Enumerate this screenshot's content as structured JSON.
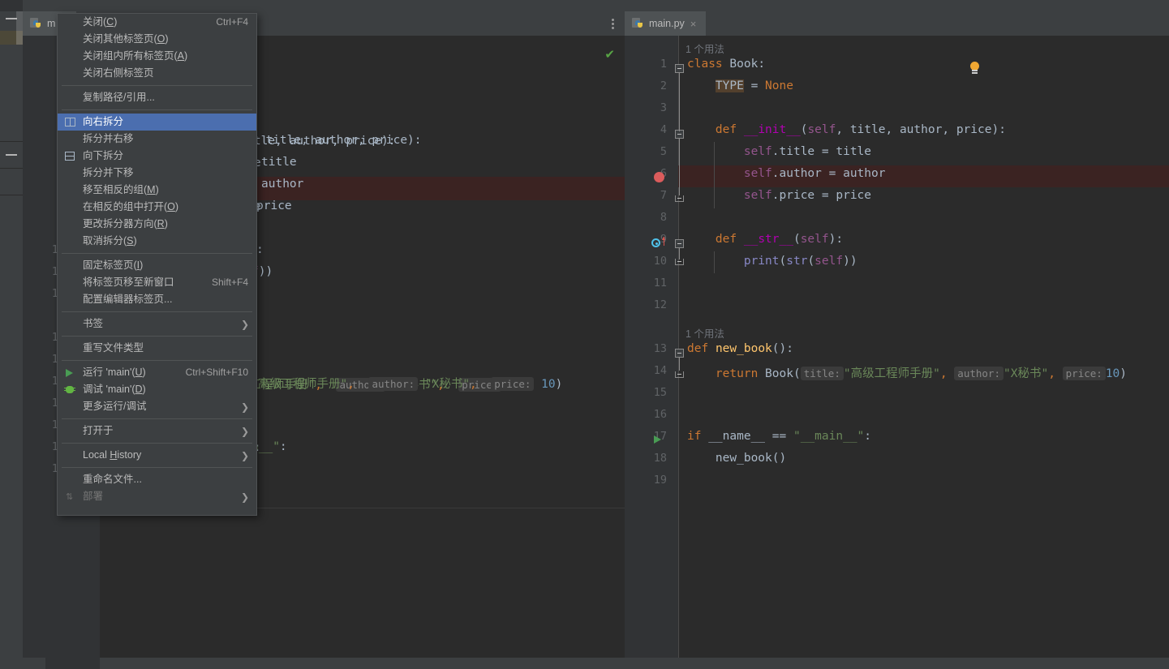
{
  "window": {
    "left_tab": {
      "label": "m",
      "icon": "python-file-icon"
    },
    "right_tab": {
      "label": "main.py",
      "icon": "python-file-icon",
      "close": "×"
    },
    "inspection_ok": "✔",
    "options_menu": "more-options-icon"
  },
  "context_menu": {
    "items": [
      {
        "kind": "item",
        "label": "关闭(C)",
        "underline": "C",
        "accel": "Ctrl+F4",
        "icon": "",
        "selected": false,
        "disabled": false,
        "submenu": false
      },
      {
        "kind": "item",
        "label": "关闭其他标签页(O)",
        "underline": "O",
        "accel": "",
        "icon": "",
        "selected": false,
        "disabled": false,
        "submenu": false
      },
      {
        "kind": "item",
        "label": "关闭组内所有标签页(A)",
        "underline": "A",
        "accel": "",
        "icon": "",
        "selected": false,
        "disabled": false,
        "submenu": false
      },
      {
        "kind": "item",
        "label": "关闭右侧标签页",
        "underline": "",
        "accel": "",
        "icon": "",
        "selected": false,
        "disabled": false,
        "submenu": false
      },
      {
        "kind": "sep"
      },
      {
        "kind": "item",
        "label": "复制路径/引用...",
        "underline": "",
        "accel": "",
        "icon": "",
        "selected": false,
        "disabled": false,
        "submenu": false
      },
      {
        "kind": "sep"
      },
      {
        "kind": "item",
        "label": "向右拆分",
        "underline": "",
        "accel": "",
        "icon": "split-right-icon",
        "selected": true,
        "disabled": false,
        "submenu": false
      },
      {
        "kind": "item",
        "label": "拆分并右移",
        "underline": "",
        "accel": "",
        "icon": "",
        "selected": false,
        "disabled": false,
        "submenu": false
      },
      {
        "kind": "item",
        "label": "向下拆分",
        "underline": "",
        "accel": "",
        "icon": "split-down-icon",
        "selected": false,
        "disabled": false,
        "submenu": false
      },
      {
        "kind": "item",
        "label": "拆分并下移",
        "underline": "",
        "accel": "",
        "icon": "",
        "selected": false,
        "disabled": false,
        "submenu": false
      },
      {
        "kind": "item",
        "label": "移至相反的组(M)",
        "underline": "M",
        "accel": "",
        "icon": "",
        "selected": false,
        "disabled": false,
        "submenu": false
      },
      {
        "kind": "item",
        "label": "在相反的组中打开(O)",
        "underline": "O",
        "accel": "",
        "icon": "",
        "selected": false,
        "disabled": false,
        "submenu": false
      },
      {
        "kind": "item",
        "label": "更改拆分器方向(R)",
        "underline": "R",
        "accel": "",
        "icon": "",
        "selected": false,
        "disabled": false,
        "submenu": false
      },
      {
        "kind": "item",
        "label": "取消拆分(S)",
        "underline": "S",
        "accel": "",
        "icon": "",
        "selected": false,
        "disabled": false,
        "submenu": false
      },
      {
        "kind": "sep"
      },
      {
        "kind": "item",
        "label": "固定标签页(I)",
        "underline": "I",
        "accel": "",
        "icon": "",
        "selected": false,
        "disabled": false,
        "submenu": false
      },
      {
        "kind": "item",
        "label": "将标签页移至新窗口",
        "underline": "",
        "accel": "Shift+F4",
        "icon": "",
        "selected": false,
        "disabled": false,
        "submenu": false
      },
      {
        "kind": "item",
        "label": "配置编辑器标签页...",
        "underline": "",
        "accel": "",
        "icon": "",
        "selected": false,
        "disabled": false,
        "submenu": false
      },
      {
        "kind": "sep"
      },
      {
        "kind": "item",
        "label": "书签",
        "underline": "",
        "accel": "",
        "icon": "",
        "selected": false,
        "disabled": false,
        "submenu": true
      },
      {
        "kind": "sep"
      },
      {
        "kind": "item",
        "label": "重写文件类型",
        "underline": "",
        "accel": "",
        "icon": "",
        "selected": false,
        "disabled": false,
        "submenu": false
      },
      {
        "kind": "sep"
      },
      {
        "kind": "item",
        "label": "运行 'main'(U)",
        "underline": "U",
        "accel": "Ctrl+Shift+F10",
        "icon": "run-icon",
        "selected": false,
        "disabled": false,
        "submenu": false
      },
      {
        "kind": "item",
        "label": "调试 'main'(D)",
        "underline": "D",
        "accel": "",
        "icon": "debug-icon",
        "selected": false,
        "disabled": false,
        "submenu": false
      },
      {
        "kind": "item",
        "label": "更多运行/调试",
        "underline": "",
        "accel": "",
        "icon": "",
        "selected": false,
        "disabled": false,
        "submenu": true
      },
      {
        "kind": "sep"
      },
      {
        "kind": "item",
        "label": "打开于",
        "underline": "",
        "accel": "",
        "icon": "",
        "selected": false,
        "disabled": false,
        "submenu": true
      },
      {
        "kind": "sep"
      },
      {
        "kind": "item",
        "label": "Local History",
        "underline": "H",
        "accel": "",
        "icon": "",
        "selected": false,
        "disabled": false,
        "submenu": true
      },
      {
        "kind": "sep"
      },
      {
        "kind": "item",
        "label": "重命名文件...",
        "underline": "",
        "accel": "",
        "icon": "",
        "selected": false,
        "disabled": false,
        "submenu": false
      },
      {
        "kind": "item",
        "label": "部署",
        "underline": "",
        "accel": "",
        "icon": "deploy-icon",
        "selected": false,
        "disabled": true,
        "submenu": true
      }
    ]
  },
  "editor": {
    "usage_hint_class": "1 个用法",
    "usage_hint_func": "1 个用法",
    "line_numbers": [
      1,
      2,
      3,
      4,
      5,
      6,
      7,
      8,
      9,
      10,
      11,
      12,
      13,
      14,
      15,
      16,
      17,
      18,
      19
    ],
    "breakpoint_line": 6,
    "override_line": 9,
    "run_marker_line": 17,
    "lines": {
      "1": "class Book:",
      "2": "    TYPE = None",
      "3": "",
      "4": "    def __init__(self, title, author, price):",
      "5": "        self.title = title",
      "6": "        self.author = author",
      "7": "        self.price = price",
      "8": "",
      "9": "    def __str__(self):",
      "10": "        print(str(self))",
      "11": "",
      "12": "",
      "13": "def new_book():",
      "14": "    return Book(title: \"高级工程师手册\", author: \"X秘书\", price: 10)",
      "15": "",
      "16": "",
      "17": "if __name__ == \"__main__\":",
      "18": "    new_book()",
      "19": ""
    },
    "tokens": {
      "kw_class": "class",
      "name_book": "Book",
      "const_type": "TYPE",
      "none": "None",
      "kw_def": "def",
      "init": "__init__",
      "str_": "__str__",
      "self": "self",
      "title": "title",
      "author": "author",
      "price": "price",
      "print": "print",
      "str_fn": "str",
      "new_book": "new_book",
      "kw_return": "return",
      "kw_if": "if",
      "dunder_name": "__name__",
      "main_literal": "\"__main__\"",
      "hint_title": "title:",
      "hint_author": "author:",
      "hint_price": "price:",
      "lit_title": "\"高级工程师手册\"",
      "lit_author": "\"X秘书\"",
      "lit_price": "10"
    }
  },
  "colors": {
    "background": "#2b2b2b",
    "panel": "#3c3f41",
    "gutter": "#313335",
    "selection": "#4b6eaf",
    "keyword": "#cc7832",
    "function": "#ffc66d",
    "string": "#6a8759",
    "number": "#6897bb",
    "self_param": "#94558d",
    "breakpoint": "#db5c5c",
    "run_green": "#499c54",
    "highlight_line": "#3b2322",
    "bulb": "#f0a732"
  }
}
